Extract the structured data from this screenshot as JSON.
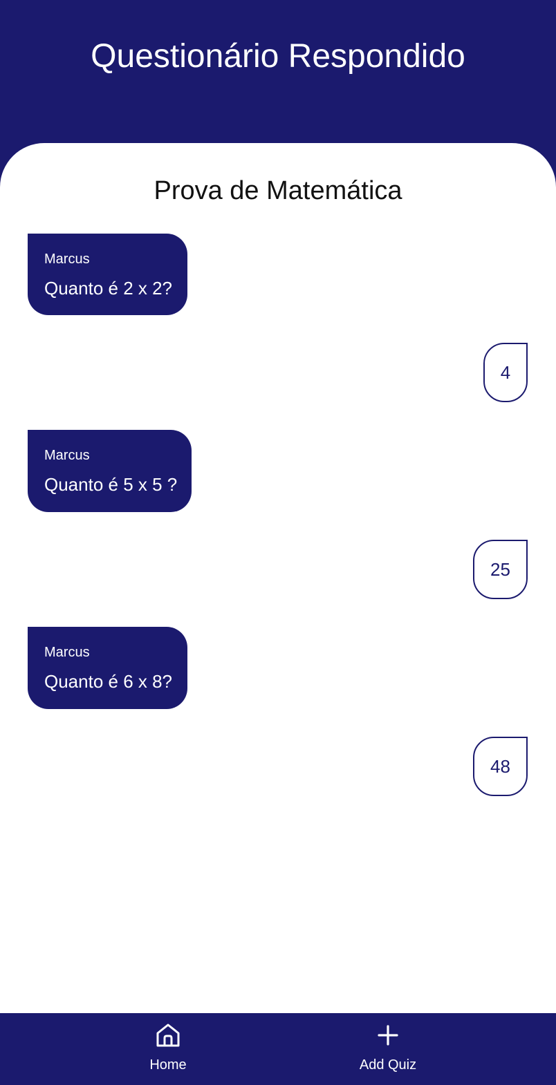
{
  "header": {
    "title": "Questionário Respondido"
  },
  "quiz": {
    "title": "Prova de Matemática",
    "items": [
      {
        "author": "Marcus",
        "question": "Quanto é 2 x 2?",
        "answer": "4"
      },
      {
        "author": "Marcus",
        "question": "Quanto é 5 x 5 ?",
        "answer": "25"
      },
      {
        "author": "Marcus",
        "question": "Quanto é 6 x 8?",
        "answer": "48"
      }
    ]
  },
  "nav": {
    "items": [
      {
        "label": "Home",
        "icon": "home-icon"
      },
      {
        "label": "Add Quiz",
        "icon": "plus-icon"
      }
    ]
  },
  "colors": {
    "primary": "#1b1a6e",
    "surface": "#ffffff"
  }
}
